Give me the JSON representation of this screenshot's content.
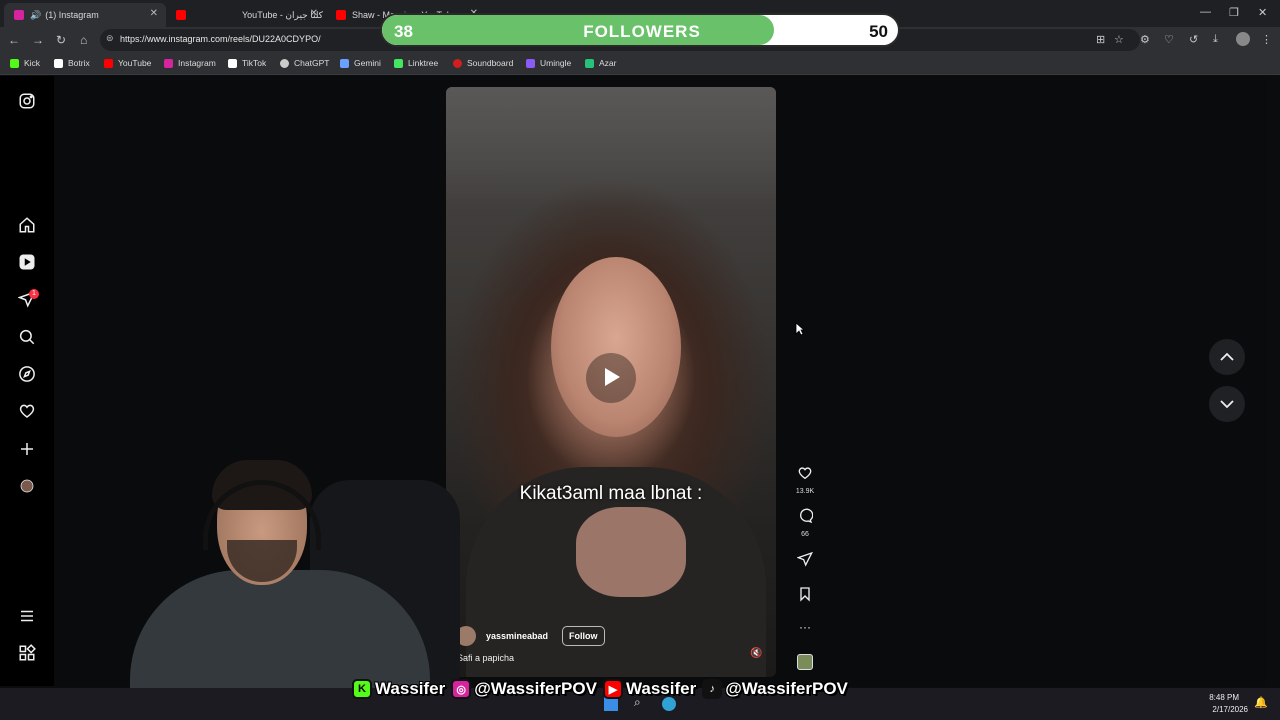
{
  "browser": {
    "tabs": [
      {
        "label": "(1) Instagram",
        "active": true
      },
      {
        "label": "YouTube - كلنا جيران",
        "active": false
      },
      {
        "label": "Shaw - Massi... - YouTube",
        "active": false
      }
    ],
    "url": "https://www.instagram.com/reels/DU22A0CDYPO/",
    "bookmarks": [
      {
        "label": "Kick",
        "color": "#53fc18"
      },
      {
        "label": "Botrix",
        "color": "#ffffff"
      },
      {
        "label": "YouTube",
        "color": "#ff0000"
      },
      {
        "label": "Instagram",
        "color": "#d6249f"
      },
      {
        "label": "TikTok",
        "color": "#ffffff"
      },
      {
        "label": "ChatGPT",
        "color": "#cccccc"
      },
      {
        "label": "Gemini",
        "color": "#6aa0ff"
      },
      {
        "label": "Linktree",
        "color": "#43e660"
      },
      {
        "label": "Soundboard",
        "color": "#d11f1f"
      },
      {
        "label": "Umingle",
        "color": "#8a5cf5"
      },
      {
        "label": "Azar",
        "color": "#27c27a"
      }
    ]
  },
  "followers_goal": {
    "current": "38",
    "title": "FOLLOWERS",
    "goal": "50",
    "progress": 0.76,
    "fill_color": "#69c26a"
  },
  "sidebar": {
    "icons": [
      "instagram-logo-icon",
      "home-icon",
      "reels-icon",
      "messages-icon",
      "search-icon",
      "explore-icon",
      "heart-icon",
      "create-icon",
      "profile-avatar",
      "menu-icon",
      "apps-icon"
    ],
    "notification_count": "1"
  },
  "reel": {
    "overlay_text": "Kikat3aml maa lbnat :",
    "username": "yassmineabad",
    "follow_label": "Follow",
    "description": "Safi a papicha",
    "likes": "13.9K",
    "comments": "66"
  },
  "streamer": {
    "handles": [
      {
        "platform": "kick-icon",
        "handle": "Wassifer",
        "color": "#53fc18"
      },
      {
        "platform": "instagram-icon",
        "handle": "@WassiferPOV",
        "color": "#d6249f"
      },
      {
        "platform": "youtube-icon",
        "handle": "Wassifer",
        "color": "#ff0000"
      },
      {
        "platform": "tiktok-icon",
        "handle": "@WassiferPOV",
        "color": "#111111"
      }
    ]
  },
  "taskbar": {
    "time": "8:48 PM",
    "date": "2/17/2026"
  }
}
